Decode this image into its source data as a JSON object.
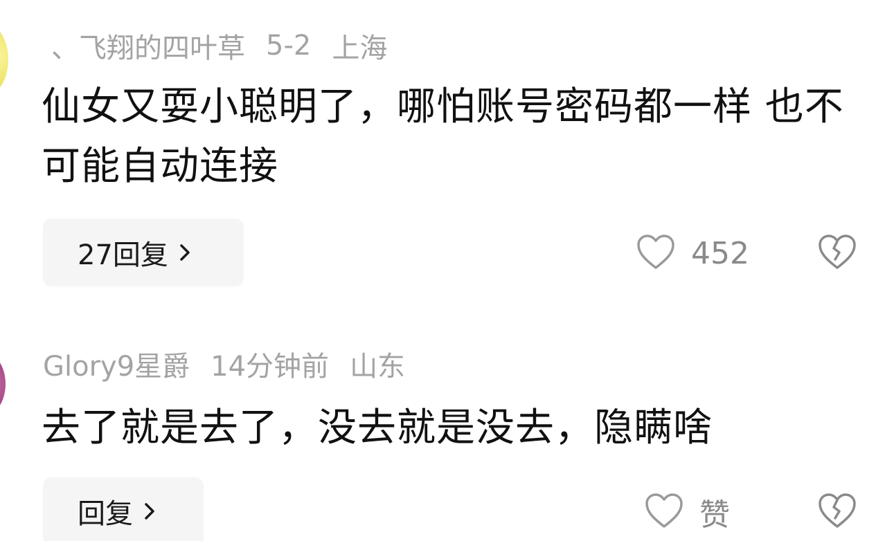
{
  "comments": [
    {
      "username": "、飞翔的四叶草",
      "time": "5-2",
      "location": "上海",
      "text": "仙女又耍小聪明了，哪怕账号密码都一样 也不可能自动连接",
      "reply_label": "27回复",
      "like_count": "452"
    },
    {
      "username": "Glory9星爵",
      "time": "14分钟前",
      "location": "山东",
      "text": "去了就是去了，没去就是没去，隐瞒啥",
      "reply_label": "回复",
      "like_count": "赞"
    }
  ],
  "icons": {
    "reply_chevron": "chevron-right-icon",
    "like": "heart-outline-icon",
    "dislike": "broken-heart-icon"
  },
  "colors": {
    "meta_text": "#a3a3a3",
    "body_text": "#111111",
    "reply_bg": "#f5f5f5",
    "icon_stroke": "#9a9a9a"
  }
}
